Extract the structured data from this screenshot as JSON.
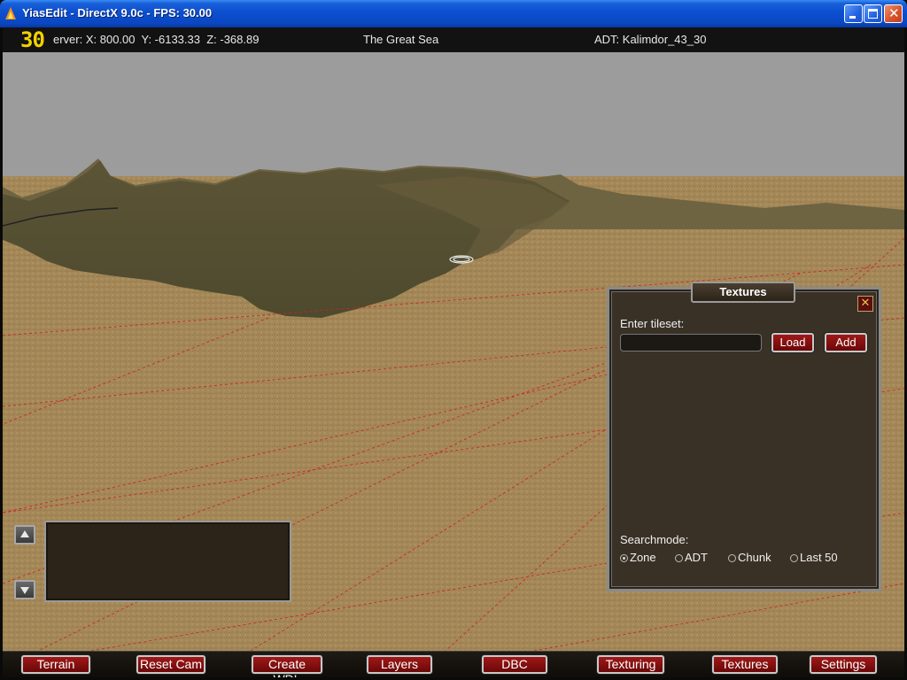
{
  "window": {
    "title": "YiasEdit - DirectX 9.0c - FPS: 30.00",
    "minimize_icon": "minimize-icon",
    "maximize_icon": "maximize-icon",
    "close_icon": "close-icon",
    "close_glyph": "✕"
  },
  "infobar": {
    "fps_overlay": "30",
    "coords": "erver: X: 800.00  Y: -6133.33  Z: -368.89",
    "zone": "The Great Sea",
    "adt": "ADT: Kalimdor_43_30"
  },
  "textures_window": {
    "title": "Textures",
    "close_glyph": "✕",
    "tileset_label": "Enter tileset:",
    "tileset_value": "",
    "load_label": "Load",
    "add_label": "Add",
    "searchmode_label": "Searchmode:",
    "searchmodes": [
      {
        "label": "Zone",
        "selected": true
      },
      {
        "label": "ADT",
        "selected": false
      },
      {
        "label": "Chunk",
        "selected": false
      },
      {
        "label": "Last 50",
        "selected": false
      }
    ]
  },
  "console": {
    "up_icon": "arrow-up-icon",
    "down_icon": "arrow-down-icon"
  },
  "menu": {
    "items": [
      "Terrain",
      "Reset Cam",
      "Create WDL",
      "Layers",
      "DBC",
      "Texturing",
      "Textures",
      "Settings"
    ]
  },
  "colors": {
    "sky": "#9c9c9c",
    "ground": "#a48858",
    "hills": "#585032",
    "grid": "#d02020",
    "button_red": "#8a1010",
    "fps_yellow": "#f2d200"
  }
}
